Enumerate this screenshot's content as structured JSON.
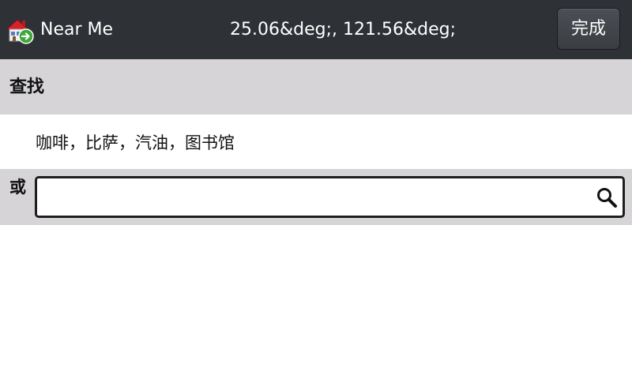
{
  "titlebar": {
    "app_icon": "near-me-house-icon",
    "app_title": "Near Me",
    "coordinates": "25.06&deg;, 121.56&deg;",
    "done_label": "完成"
  },
  "find": {
    "header_label": "查找",
    "suggestions": "咖啡，比萨，汽油，图书馆"
  },
  "or_section": {
    "label": "或",
    "search_value": "",
    "search_icon": "search-icon"
  },
  "colors": {
    "titlebar_bg": "#2e3136",
    "section_bg": "#d6d4d7",
    "content_bg": "#ffffff"
  }
}
